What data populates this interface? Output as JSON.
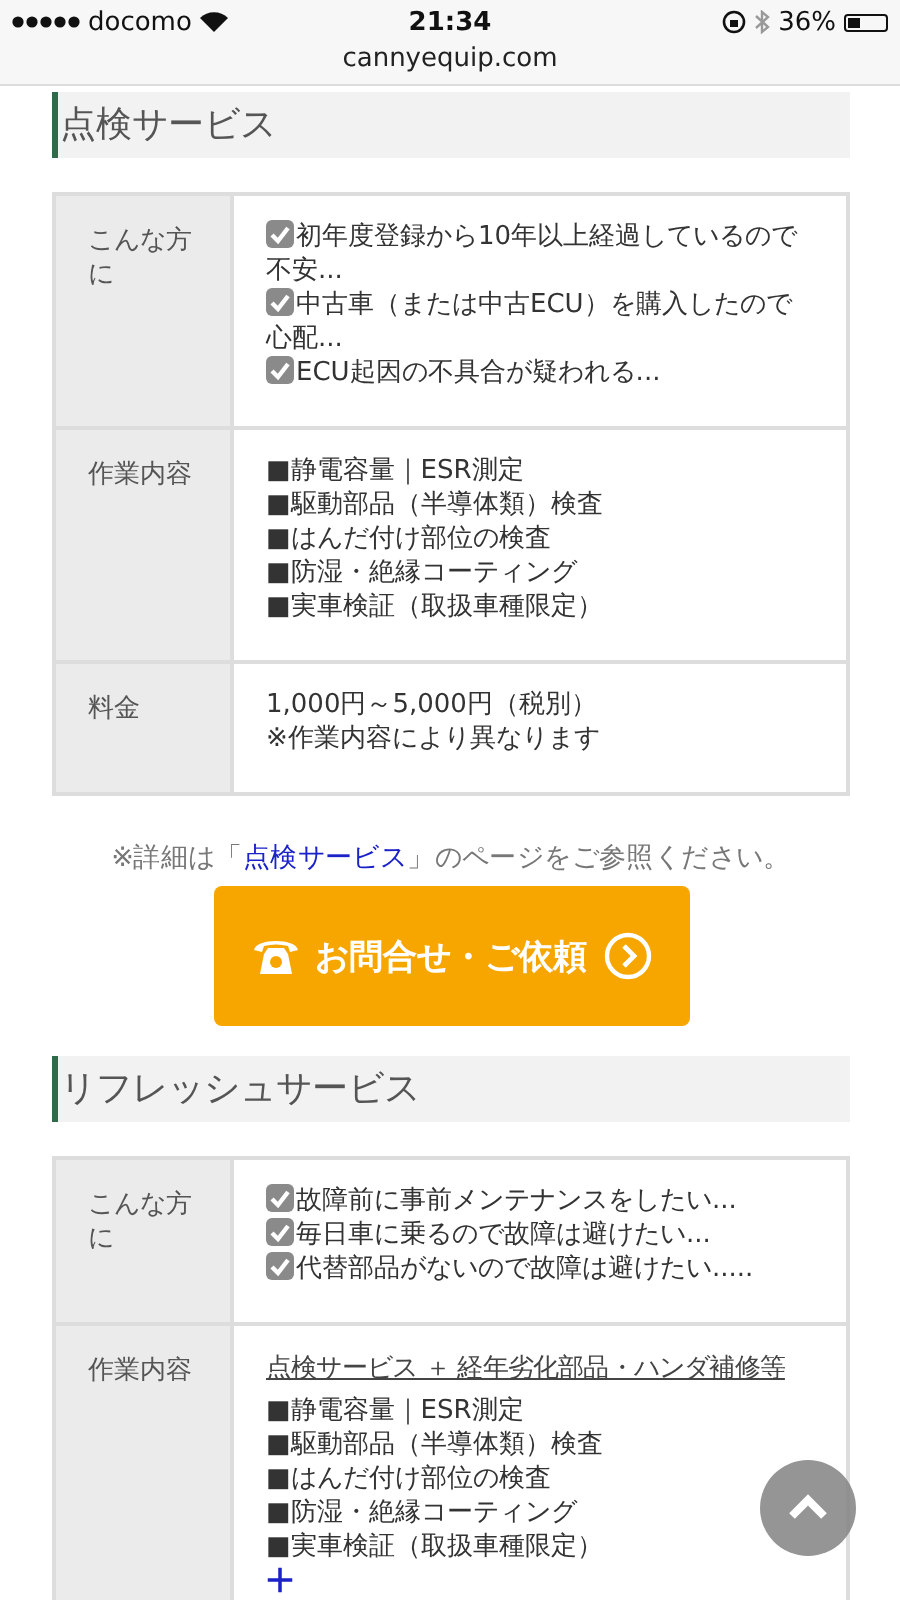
{
  "status_bar": {
    "carrier": "docomo",
    "time": "21:34",
    "battery": "36%"
  },
  "url": "cannyequip.com",
  "sections": [
    {
      "heading": "点検サービス",
      "rows": [
        {
          "label": "こんな方に",
          "kind": "checklist",
          "items": [
            {
              "text": "初年度登録から10年以上経過しているので不安...",
              "checked": true
            },
            {
              "text": "中古車（または中古ECU）を購入したので心配...",
              "checked": true
            },
            {
              "text": "ECU起因の不具合が疑われる...",
              "checked": true
            }
          ]
        },
        {
          "label": "作業内容",
          "kind": "list",
          "expandable": false,
          "items": [
            "■静電容量｜ESR測定",
            "■駆動部品（半導体類）検査",
            "■はんだ付け部位の検査",
            "■防湿・絶縁コーティング",
            "■実車検証（取扱車種限定）"
          ]
        },
        {
          "label": "料金",
          "kind": "lines",
          "items": [
            "1,000円～5,000円（税別）",
            "※作業内容により異なります"
          ]
        }
      ],
      "note": {
        "before": "※詳細は「",
        "link": "点検サービス",
        "after": "」のページをご参照ください。"
      },
      "button": {
        "label": "お問合せ・ご依頼"
      }
    },
    {
      "heading": "リフレッシュサービス",
      "rows": [
        {
          "label": "こんな方に",
          "kind": "checklist",
          "items": [
            {
              "text": "故障前に事前メンテナンスをしたい...",
              "checked": true
            },
            {
              "text": "毎日車に乗るので故障は避けたい...",
              "checked": true
            },
            {
              "text": "代替部品がないので故障は避けたい.....",
              "checked": true
            }
          ]
        },
        {
          "label": "作業内容",
          "kind": "list",
          "link": "点検サービス ＋ 経年劣化部品・ハンダ補修等",
          "expandable": true,
          "items": [
            "■静電容量｜ESR測定",
            "■駆動部品（半導体類）検査",
            "■はんだ付け部位の検査",
            "■防湿・絶縁コーティング",
            "■実車検証（取扱車種限定）"
          ]
        }
      ]
    }
  ]
}
